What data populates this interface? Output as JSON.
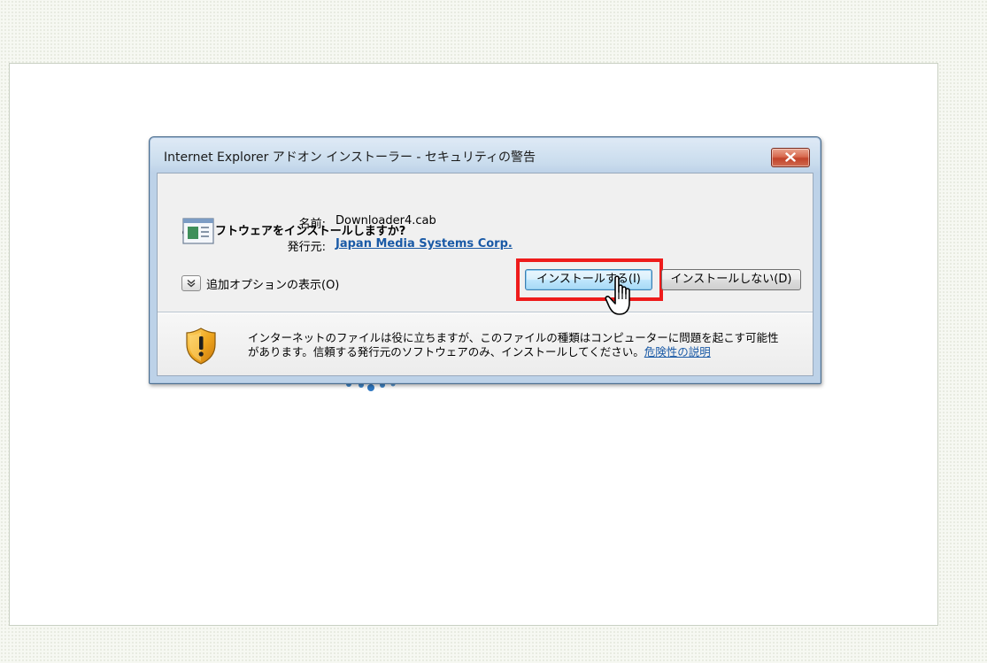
{
  "dialog": {
    "title": "Internet Explorer アドオン インストーラー - セキュリティの警告",
    "question": "このソフトウェアをインストールしますか?",
    "name_label": "名前:",
    "name_value": "Downloader4.cab",
    "publisher_label": "発行元:",
    "publisher_value": "Japan Media Systems Corp.",
    "more_options_label": "追加オプションの表示(O)",
    "install_button": "インストールする(I)",
    "dont_install_button": "インストールしない(D)",
    "warning_text": "インターネットのファイルは役に立ちますが、このファイルの種類はコンピューターに問題を起こす可能性があります。信頼する発行元のソフトウェアのみ、インストールしてください。",
    "risk_link": "危険性の説明"
  },
  "colors": {
    "highlight_border": "#ee1b1b",
    "link": "#1a5aa6",
    "close_button": "#c2432a"
  },
  "icons": {
    "close": "close-icon",
    "file": "cab-file-icon",
    "expand": "chevron-down-icon",
    "shield": "security-shield-icon",
    "cursor": "hand-cursor-icon"
  }
}
